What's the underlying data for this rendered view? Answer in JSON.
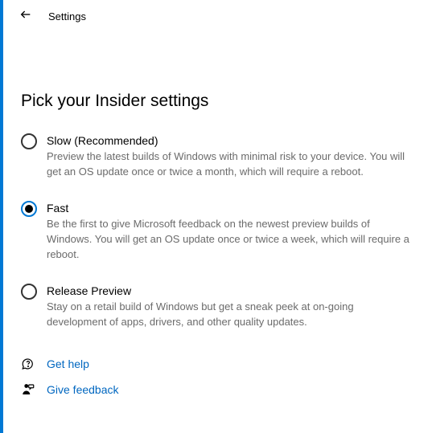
{
  "header": {
    "title": "Settings"
  },
  "page": {
    "title": "Pick your Insider settings"
  },
  "options": [
    {
      "label": "Slow (Recommended)",
      "description": "Preview the latest builds of Windows with minimal risk to your device. You will get an OS update once or twice a month, which will require a reboot.",
      "selected": false
    },
    {
      "label": "Fast",
      "description": "Be the first to give Microsoft feedback on the newest preview builds of Windows. You will get an OS update once or twice a week, which will require a reboot.",
      "selected": true
    },
    {
      "label": "Release Preview",
      "description": "Stay on a retail build of Windows but get a sneak peek at on-going development of apps, drivers, and other quality updates.",
      "selected": false
    }
  ],
  "links": {
    "help": "Get help",
    "feedback": "Give feedback"
  }
}
